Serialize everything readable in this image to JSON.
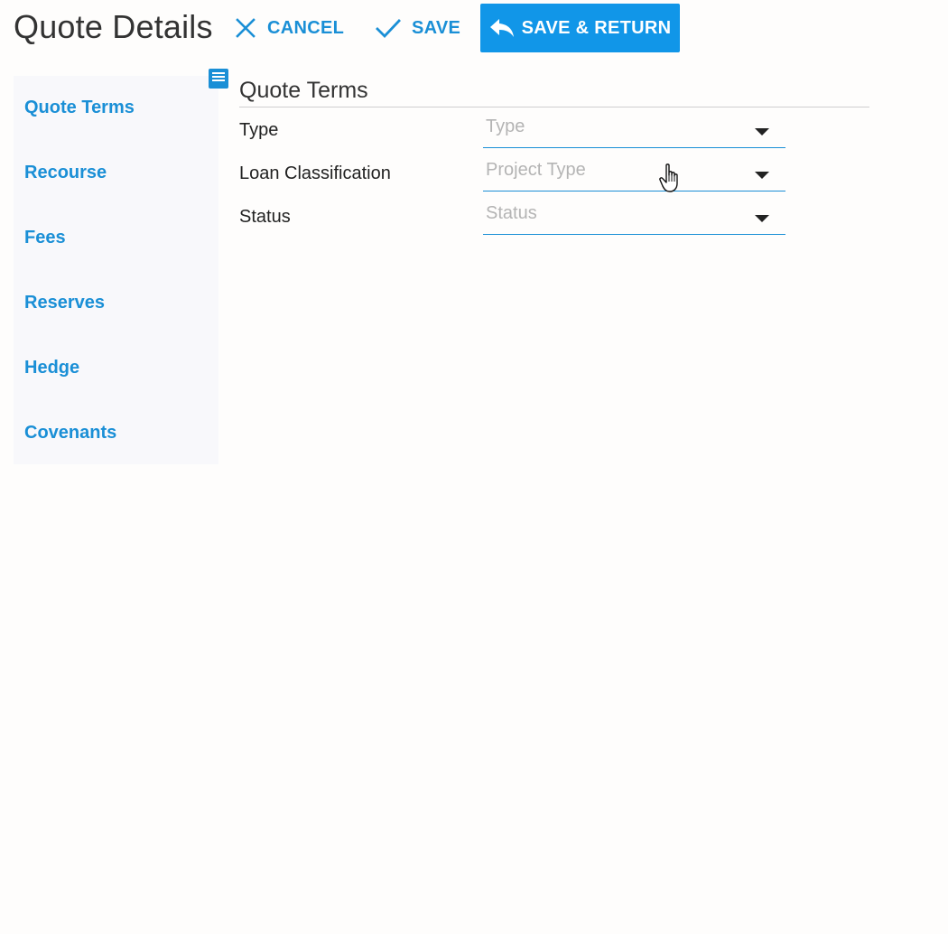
{
  "header": {
    "title": "Quote Details",
    "cancel_label": "CANCEL",
    "save_label": "SAVE",
    "save_return_label": "SAVE & RETURN"
  },
  "sidebar": {
    "items": [
      {
        "label": "Quote Terms"
      },
      {
        "label": "Recourse"
      },
      {
        "label": "Fees"
      },
      {
        "label": "Reserves"
      },
      {
        "label": "Hedge"
      },
      {
        "label": "Covenants"
      }
    ]
  },
  "section": {
    "title": "Quote Terms",
    "fields": [
      {
        "label": "Type",
        "placeholder": "Type"
      },
      {
        "label": "Loan Classification",
        "placeholder": "Project Type"
      },
      {
        "label": "Status",
        "placeholder": "Status"
      }
    ]
  },
  "colors": {
    "accent": "#1a8fd6",
    "primary_button": "#1196e8",
    "sidebar_bg": "#f8f8fb",
    "placeholder": "#b4b4b4"
  },
  "icons": {
    "cancel": "close-icon",
    "save": "check-icon",
    "save_return": "reply-arrow-icon",
    "sidebar_toggle": "menu-icon",
    "dropdown": "caret-down-icon",
    "cursor": "hand-pointer-icon"
  }
}
